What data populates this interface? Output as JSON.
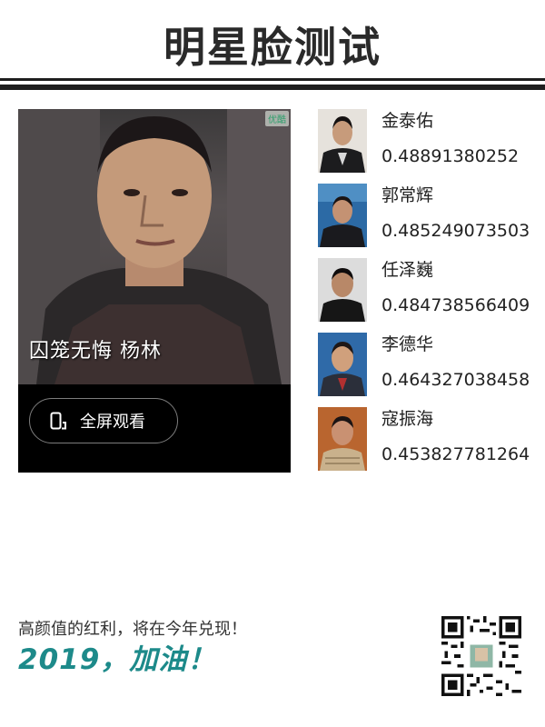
{
  "header": {
    "title": "明星脸测试"
  },
  "video": {
    "watermark": "优酷",
    "caption": "囚笼无悔 杨林",
    "fullscreen_label": "全屏观看"
  },
  "matches": [
    {
      "name": "金泰佑",
      "score": "0.48891380252"
    },
    {
      "name": "郭常辉",
      "score": "0.485249073503"
    },
    {
      "name": "任泽巍",
      "score": "0.484738566409"
    },
    {
      "name": "李德华",
      "score": "0.464327038458"
    },
    {
      "name": "寇振海",
      "score": "0.453827781264"
    }
  ],
  "footer": {
    "slogan": "高颜值的红利，将在今年兑现！",
    "year_text": "2019，加油！"
  },
  "colors": {
    "accent": "#1d8a8a",
    "rule": "#1e1e1e"
  }
}
